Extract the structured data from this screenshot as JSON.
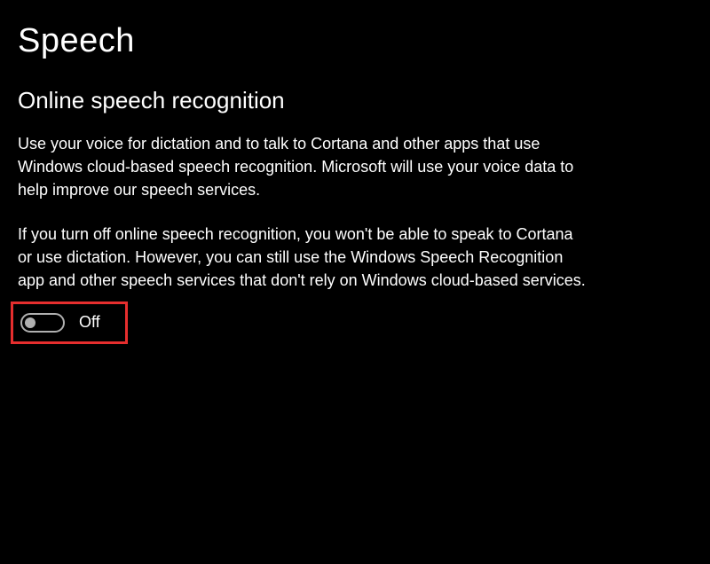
{
  "page": {
    "title": "Speech"
  },
  "section": {
    "heading": "Online speech recognition",
    "description1": "Use your voice for dictation and to talk to Cortana and other apps that use Windows cloud-based speech recognition. Microsoft will use your voice data to help improve our speech services.",
    "description2": "If you turn off online speech recognition, you won't be able to speak to Cortana or use dictation. However, you can still use the Windows Speech Recognition app and other speech services that don't rely on Windows cloud-based services."
  },
  "toggle": {
    "state": "off",
    "label": "Off"
  },
  "colors": {
    "highlight": "#e62e2e",
    "background": "#000000",
    "text": "#ffffff"
  }
}
